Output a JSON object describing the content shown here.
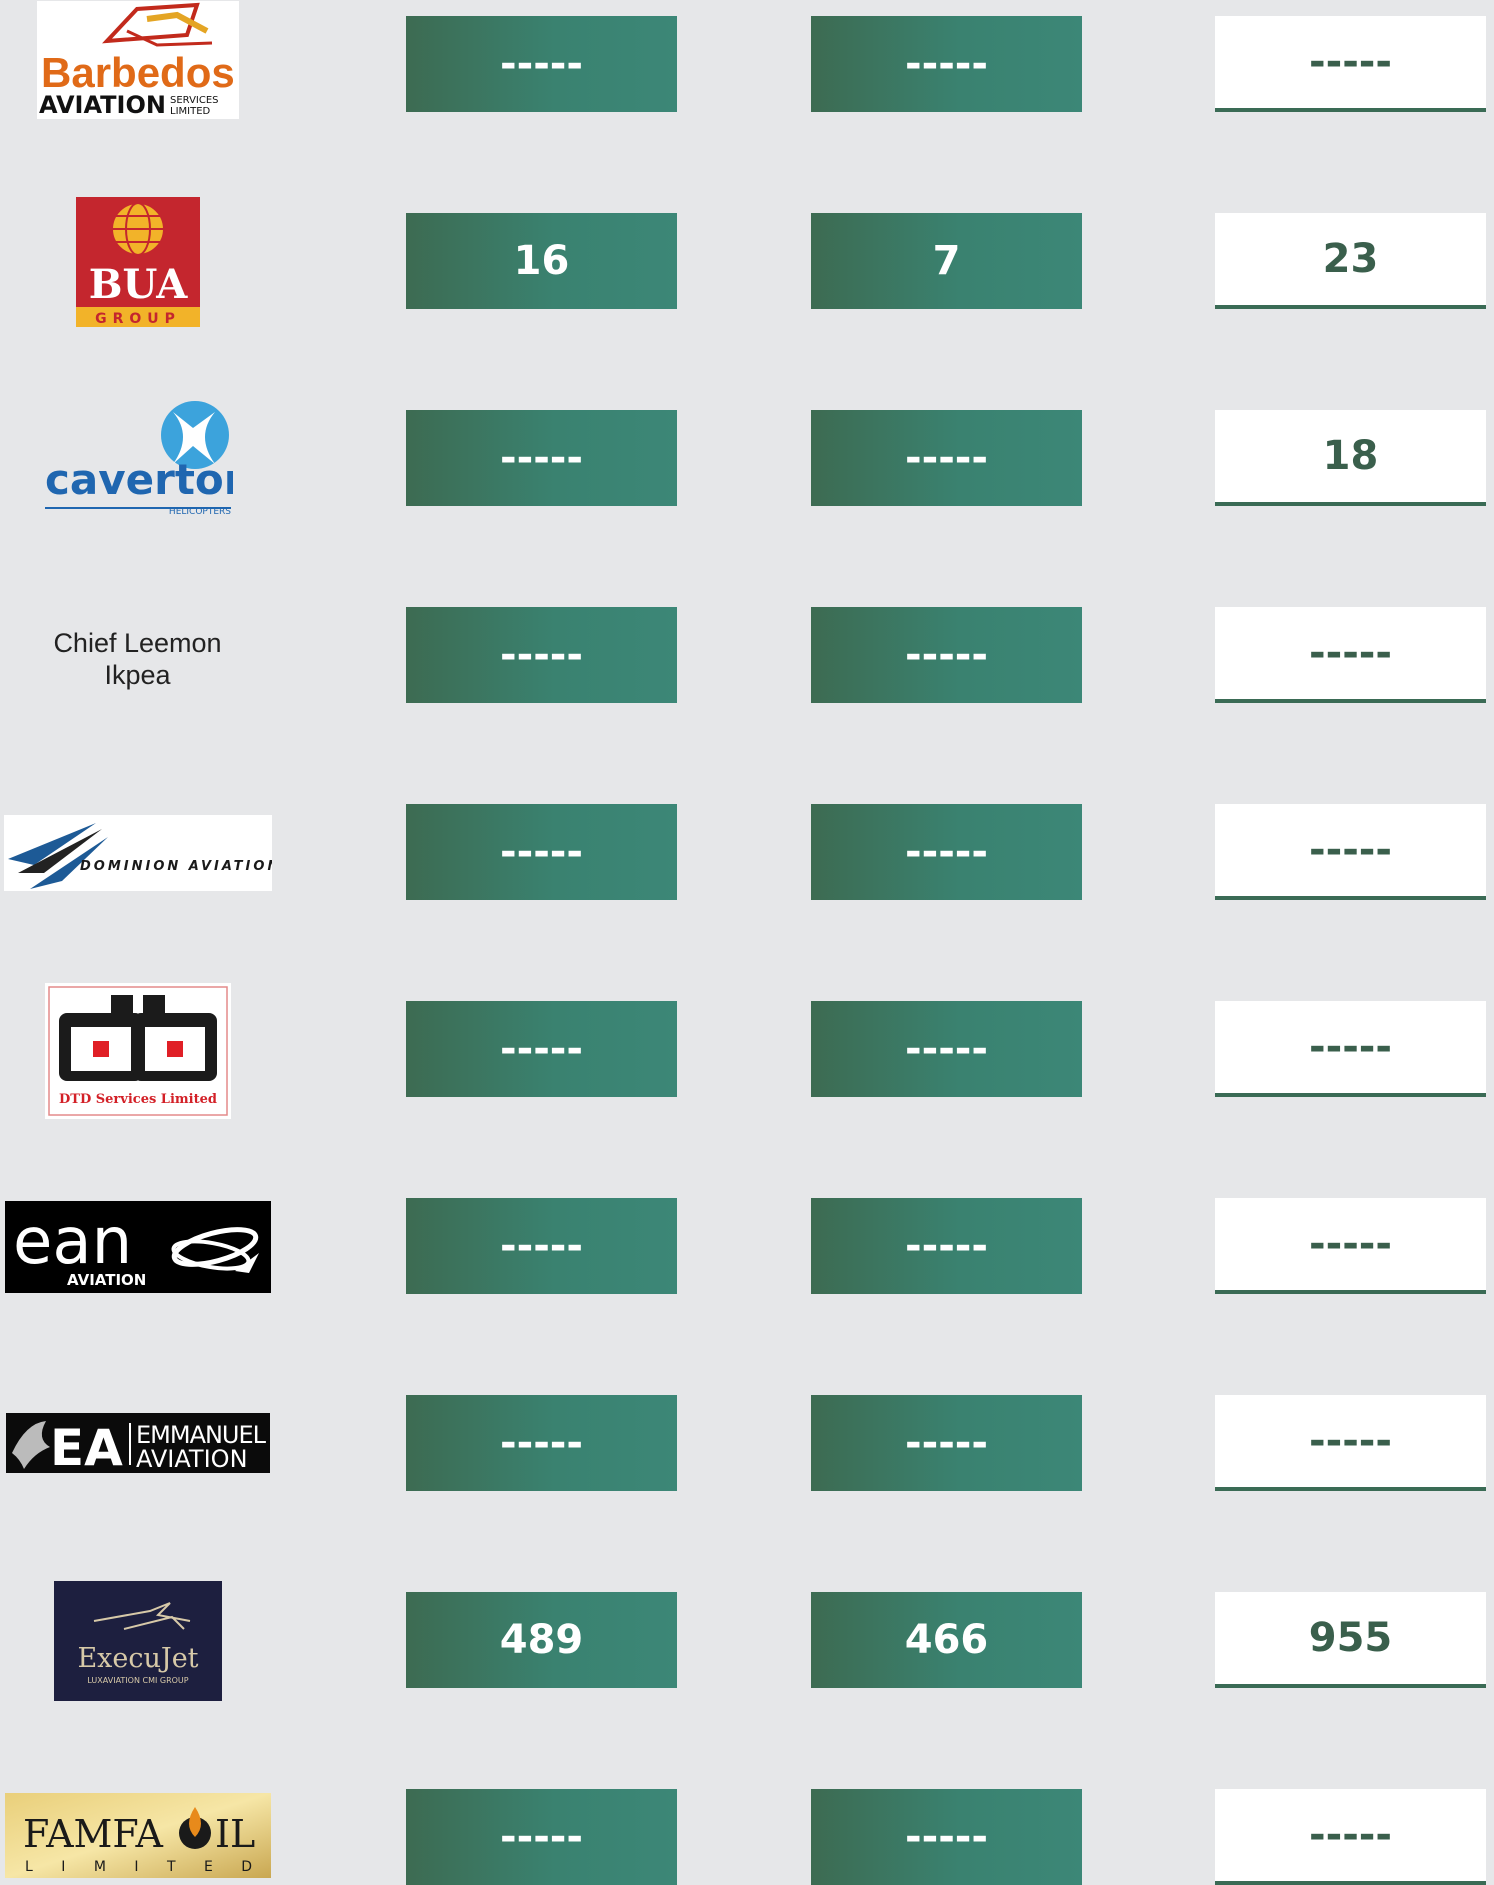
{
  "rows": [
    {
      "company": "Barbedos Aviation Services Limited",
      "logo": "barbedos-logo",
      "c1": "-----",
      "c2": "-----",
      "c3": "-----"
    },
    {
      "company": "BUA Group",
      "logo": "bua-logo",
      "c1": "16",
      "c2": "7",
      "c3": "23"
    },
    {
      "company": "Caverton Helicopters",
      "logo": "caverton-logo",
      "c1": "-----",
      "c2": "-----",
      "c3": "18"
    },
    {
      "company": "Chief Leemon Ikpea",
      "logo": "",
      "c1": "-----",
      "c2": "-----",
      "c3": "-----"
    },
    {
      "company": "Dominion Aviation",
      "logo": "dominion-logo",
      "c1": "-----",
      "c2": "-----",
      "c3": "-----"
    },
    {
      "company": "DTD Services Limited",
      "logo": "dtd-logo",
      "c1": "-----",
      "c2": "-----",
      "c3": "-----"
    },
    {
      "company": "EAN Aviation",
      "logo": "ean-logo",
      "c1": "-----",
      "c2": "-----",
      "c3": "-----"
    },
    {
      "company": "Emmanuel Aviation",
      "logo": "emmanuel-logo",
      "c1": "-----",
      "c2": "-----",
      "c3": "-----"
    },
    {
      "company": "ExecuJet Luxaviation CMI Group",
      "logo": "execujet-logo",
      "c1": "489",
      "c2": "466",
      "c3": "955"
    },
    {
      "company": "Famfa Oil Limited",
      "logo": "famfa-logo",
      "c1": "-----",
      "c2": "-----",
      "c3": "-----"
    }
  ],
  "logos": {
    "barbedos": {
      "line1": "Barbedos",
      "line2": "AVIATION",
      "line3a": "SERVICES",
      "line3b": "LIMITED"
    },
    "bua": {
      "name": "BUA",
      "sub": "GROUP"
    },
    "caverton": {
      "name": "caverton",
      "sub": "HELICOPTERS"
    },
    "chief": {
      "line1": "Chief Leemon",
      "line2": "Ikpea"
    },
    "dominion": {
      "name": "DOMINION AVIATION"
    },
    "dtd": {
      "name": "DTD Services Limited"
    },
    "ean": {
      "name": "ean",
      "sub": "AVIATION"
    },
    "emmanuel": {
      "mark": "EA",
      "line1": "EMMANUEL",
      "line2": "AVIATION"
    },
    "execujet": {
      "name": "ExecuJet",
      "sub": "LUXAVIATION CMI GROUP"
    },
    "famfa": {
      "name": "FAMFA",
      "name2": "IL",
      "sub": "L I M I T E D"
    }
  },
  "colors": {
    "background": "#e6e7e9",
    "green_start": "#3d6b52",
    "green_end": "#3c8777",
    "white_text": "#3a5f4c"
  }
}
